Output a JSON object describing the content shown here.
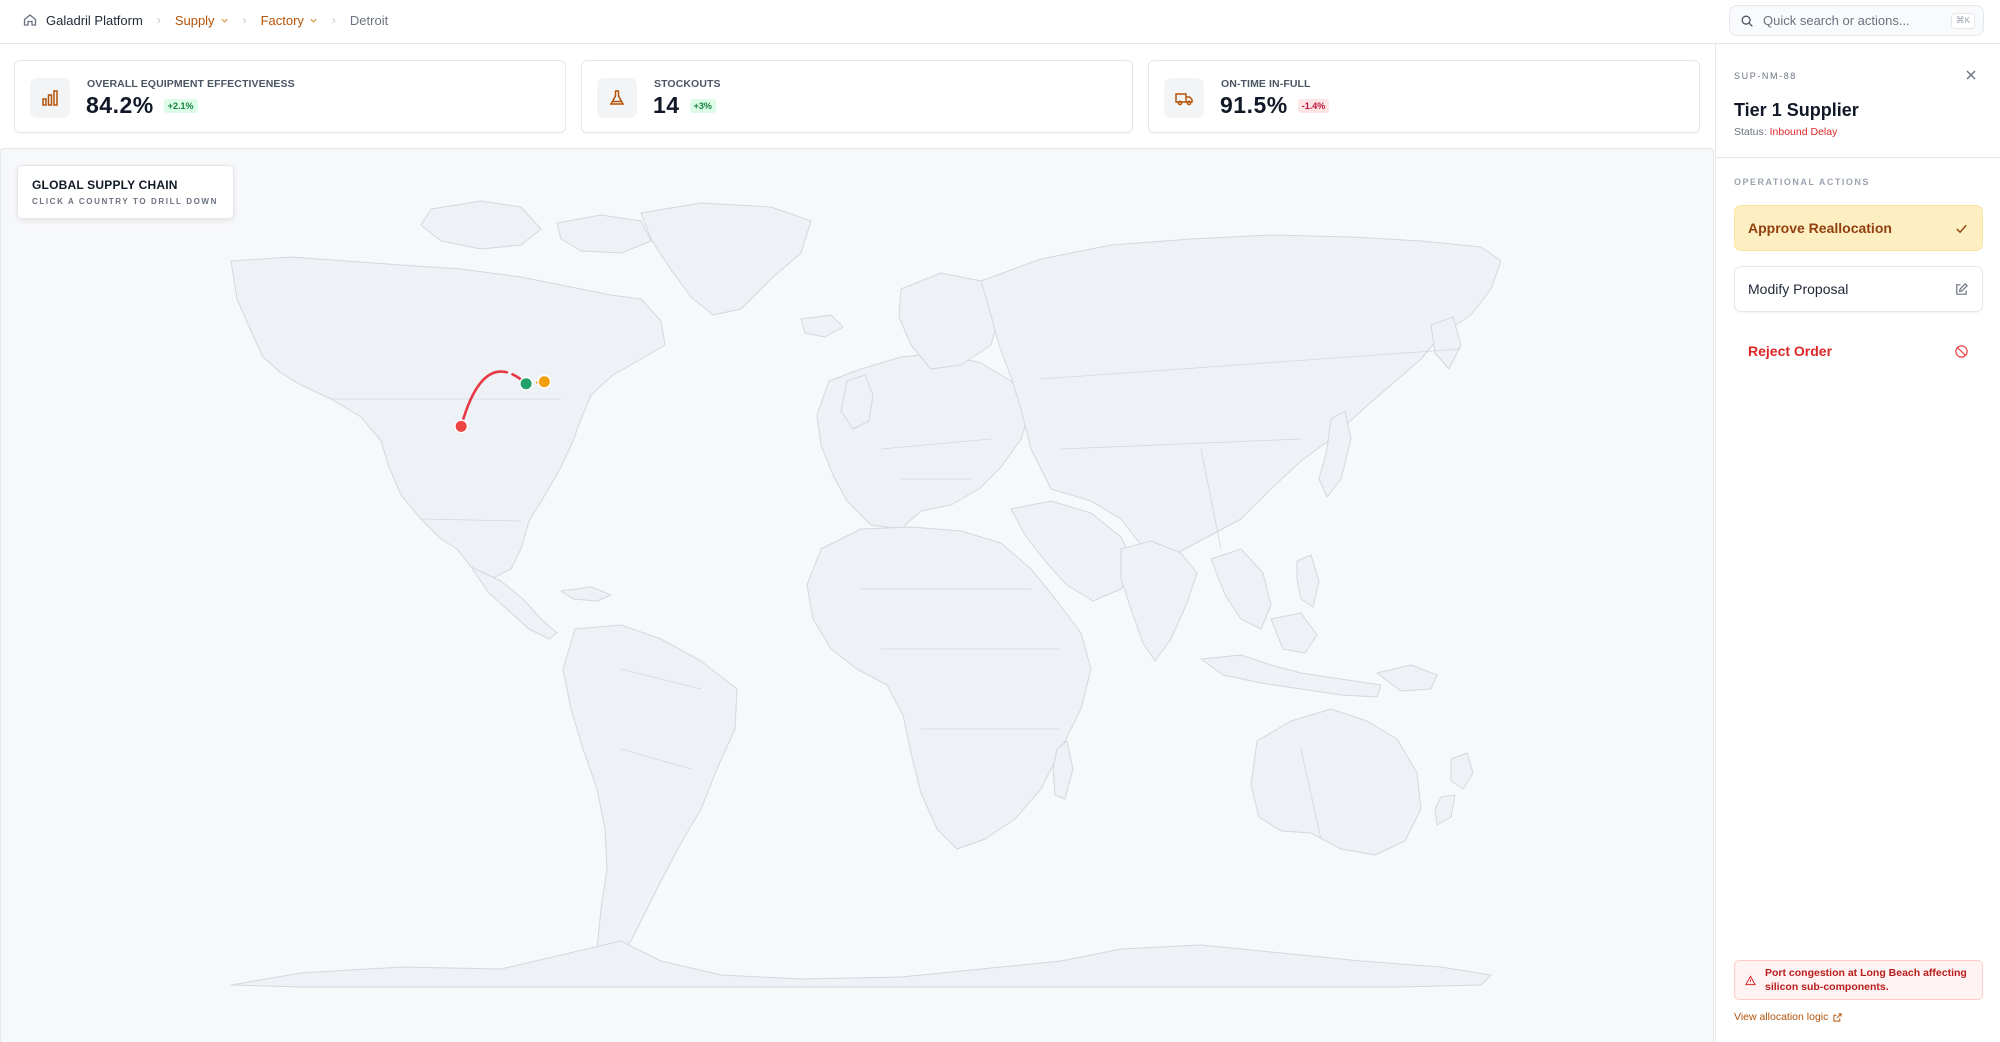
{
  "breadcrumb": {
    "root": "Galadril Platform",
    "items": [
      {
        "label": "Supply"
      },
      {
        "label": "Factory"
      }
    ],
    "current": "Detroit"
  },
  "search": {
    "placeholder": "Quick search or actions...",
    "shortcut": "⌘K"
  },
  "kpis": [
    {
      "label": "OVERALL EQUIPMENT EFFECTIVENESS",
      "value": "84.2%",
      "delta": "+2.1%",
      "trend": "up",
      "icon": "bar-chart-icon"
    },
    {
      "label": "STOCKOUTS",
      "value": "14",
      "delta": "+3%",
      "trend": "up",
      "icon": "flask-icon"
    },
    {
      "label": "ON-TIME IN-FULL",
      "value": "91.5%",
      "delta": "-1.4%",
      "trend": "down",
      "icon": "truck-icon"
    }
  ],
  "map": {
    "title": "GLOBAL SUPPLY CHAIN",
    "subtitle": "CLICK A COUNTRY TO DRILL DOWN",
    "nodes": [
      {
        "name": "supplier",
        "color": "#ef4444",
        "lon": -104.0,
        "lat": 33.2
      },
      {
        "name": "factory",
        "color": "#22a06b",
        "lon": -87.6,
        "lat": 41.9
      },
      {
        "name": "distribution",
        "color": "#f59e0b",
        "lon": -83.0,
        "lat": 42.3
      }
    ],
    "route_color": "#e63946"
  },
  "panel": {
    "id": "SUP-NM-88",
    "title": "Tier 1 Supplier",
    "status_label": "Status:",
    "status_value": "Inbound Delay",
    "section": "OPERATIONAL ACTIONS",
    "actions": {
      "approve": "Approve Reallocation",
      "modify": "Modify Proposal",
      "reject": "Reject Order"
    },
    "alert": "Port congestion at Long Beach affecting silicon sub-components.",
    "link": "View allocation logic"
  },
  "colors": {
    "accent": "#b45309",
    "danger": "#dc2626",
    "land": "#eef1f5",
    "land_stroke": "#d3d8df"
  }
}
